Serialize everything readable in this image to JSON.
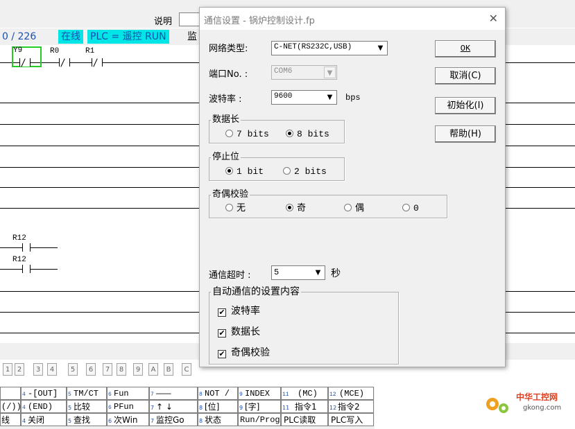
{
  "app": {
    "comment_label": "说明",
    "status": {
      "count": "0 /  226",
      "online": "在线",
      "plc": "PLC = 遥控 RUN",
      "more": "监"
    },
    "ladder": {
      "contacts_row1": [
        "Y9",
        "R0",
        "R1"
      ],
      "contacts_lower": [
        "R12",
        "R12"
      ]
    },
    "tabs": [
      "1",
      "2",
      "3",
      "4",
      "5",
      "6",
      "7",
      "8",
      "9",
      "A",
      "B",
      "C"
    ],
    "fkeys": {
      "row1": [
        {
          "n": "",
          "label": ""
        },
        {
          "n": "4",
          "label": "-[OUT]"
        },
        {
          "n": "5",
          "label": "TM/CT"
        },
        {
          "n": "6",
          "label": "Fun"
        },
        {
          "n": "7",
          "label": "———"
        },
        {
          "n": "8",
          "label": "NOT /"
        },
        {
          "n": "9",
          "label": "INDEX"
        },
        {
          "n": "11",
          "label": "(MC)"
        },
        {
          "n": "12",
          "label": "(MCE)"
        }
      ],
      "row2": [
        {
          "n": "",
          "label": "(/))"
        },
        {
          "n": "4",
          "label": "(END)"
        },
        {
          "n": "5",
          "label": "比较"
        },
        {
          "n": "6",
          "label": "PFun"
        },
        {
          "n": "7",
          "label": "↑ ↓"
        },
        {
          "n": "8",
          "label": "[位]"
        },
        {
          "n": "9",
          "label": "[字]"
        },
        {
          "n": "11",
          "label": "指令1"
        },
        {
          "n": "12",
          "label": "指令2"
        }
      ],
      "row3": [
        {
          "n": "",
          "label": "线"
        },
        {
          "n": "4",
          "label": "关闭"
        },
        {
          "n": "5",
          "label": "查找"
        },
        {
          "n": "6",
          "label": "次Win"
        },
        {
          "n": "7",
          "label": "监控Go"
        },
        {
          "n": "8",
          "label": "状态"
        },
        {
          "n": "",
          "label": "Run/Prog"
        },
        {
          "n": "",
          "label": "PLC读取"
        },
        {
          "n": "",
          "label": "PLC写入"
        }
      ]
    },
    "logo": {
      "name": "中华工控网",
      "url_text": "gkong.com"
    }
  },
  "dialog": {
    "title": "通信设置 - 锅炉控制设计.fp",
    "network_label": "网络类型:",
    "network_value": "C-NET(RS232C,USB)",
    "port_label": "端口No. :",
    "port_value": "COM6",
    "baud_label": "波特率  :",
    "baud_value": "9600",
    "baud_unit": "bps",
    "data_length": {
      "title": "数据长",
      "options": [
        "7 bits",
        "8 bits"
      ],
      "selected": 1
    },
    "stop_bit": {
      "title": "停止位",
      "options": [
        "1 bit",
        "2 bits"
      ],
      "selected": 0
    },
    "parity": {
      "title": "奇偶校验",
      "options": [
        "无",
        "奇",
        "偶",
        "0"
      ],
      "selected": 1
    },
    "timeout_label": "通信超时 :",
    "timeout_value": "5",
    "timeout_unit": "秒",
    "auto": {
      "title": "自动通信的设置内容",
      "items": [
        "波特率",
        "数据长",
        "奇偶校验"
      ],
      "checked": [
        true,
        true,
        true
      ]
    },
    "buttons": {
      "ok": "OK",
      "cancel": "取消(C)",
      "init": "初始化(I)",
      "help": "帮助(H)"
    }
  }
}
